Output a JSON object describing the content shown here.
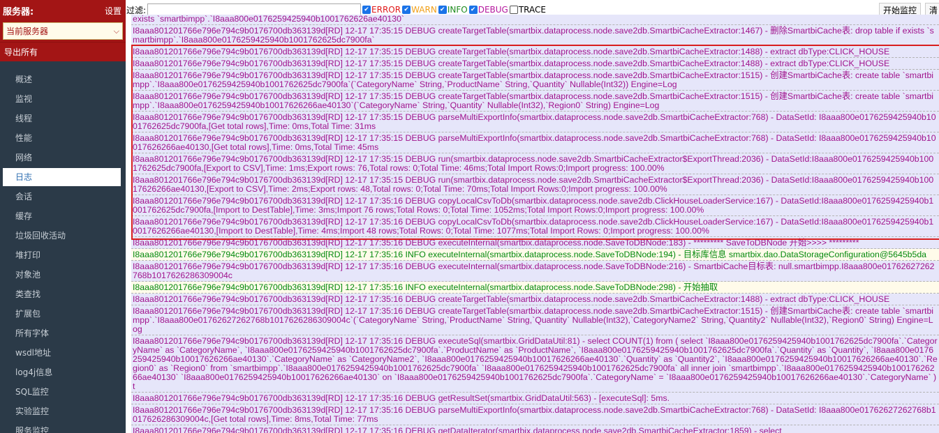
{
  "sidebar": {
    "title": "服务器:",
    "settings_label": "设置",
    "server_select": "当前服务器",
    "export_label": "导出所有",
    "items": [
      {
        "label": "概述"
      },
      {
        "label": "监视"
      },
      {
        "label": "线程"
      },
      {
        "label": "性能"
      },
      {
        "label": "网络"
      },
      {
        "label": "日志",
        "active": true
      },
      {
        "label": "会话"
      },
      {
        "label": "缓存"
      },
      {
        "label": "垃圾回收活动"
      },
      {
        "label": "堆打印"
      },
      {
        "label": "对象池"
      },
      {
        "label": "类查找"
      },
      {
        "label": "扩展包"
      },
      {
        "label": "所有字体"
      },
      {
        "label": "wsdl地址"
      },
      {
        "label": "log4j信息"
      },
      {
        "label": "SQL监控"
      },
      {
        "label": "实验监控"
      },
      {
        "label": "服务监控"
      }
    ]
  },
  "toolbar": {
    "filter_label": "过滤:",
    "filter_value": "",
    "levels": [
      {
        "label": "ERROR",
        "checked": true,
        "color": "#e01b1b"
      },
      {
        "label": "WARN",
        "checked": true,
        "color": "#f0a01a"
      },
      {
        "label": "INFO",
        "checked": true,
        "color": "#1f8c1f"
      },
      {
        "label": "DEBUG",
        "checked": true,
        "color": "#b5179e"
      },
      {
        "label": "TRACE",
        "checked": false,
        "color": "#000000"
      }
    ],
    "start_button": "开始监控",
    "clear_button": "清"
  },
  "log": [
    {
      "level": "debug",
      "text": "exists `smartbimpp`.`I8aaa800e0176259425940b1001762626ae40130`"
    },
    {
      "level": "debug",
      "text": "I8aaa801201766e796e794c9b0176700db363139d[RD] 12-17 17:35:15 DEBUG createTargetTable(smartbix.dataprocess.node.save2db.SmartbiCacheExtractor:1467) - 删除SmartbiCache表: drop table if exists `smartbimpp`.`I8aaa800e0176259425940b1001762625dc7900fa`"
    },
    {
      "level": "debug",
      "text": "I8aaa801201766e796e794c9b0176700db363139d[RD] 12-17 17:35:15 DEBUG createTargetTable(smartbix.dataprocess.node.save2db.SmartbiCacheExtractor:1488) - extract dbType:CLICK_HOUSE"
    },
    {
      "level": "debug",
      "text": "I8aaa801201766e796e794c9b0176700db363139d[RD] 12-17 17:35:15 DEBUG createTargetTable(smartbix.dataprocess.node.save2db.SmartbiCacheExtractor:1488) - extract dbType:CLICK_HOUSE"
    },
    {
      "level": "debug",
      "text": "I8aaa801201766e796e794c9b0176700db363139d[RD] 12-17 17:35:15 DEBUG createTargetTable(smartbix.dataprocess.node.save2db.SmartbiCacheExtractor:1515) - 创建SmartbiCache表: create table `smartbimpp`.`I8aaa800e0176259425940b1001762625dc7900fa`(`CategoryName` String,`ProductName` String,`Quantity` Nullable(Int32)) Engine=Log"
    },
    {
      "level": "debug",
      "text": "I8aaa801201766e796e794c9b0176700db363139d[RD] 12-17 17:35:15 DEBUG createTargetTable(smartbix.dataprocess.node.save2db.SmartbiCacheExtractor:1515) - 创建SmartbiCache表: create table `smartbimpp`.`I8aaa800e0176259425940b10017626266ae40130`(`CategoryName` String,`Quantity` Nullable(Int32),`Region0` String) Engine=Log"
    },
    {
      "level": "debug",
      "text": "I8aaa801201766e796e794c9b0176700db363139d[RD] 12-17 17:35:15 DEBUG parseMultiExportInfo(smartbix.dataprocess.node.save2db.SmartbiCacheExtractor:768) - DataSetId: I8aaa800e0176259425940b1001762625dc7900fa,[Get total rows],Time: 0ms,Total Time: 31ms"
    },
    {
      "level": "debug",
      "text": "I8aaa801201766e796e794c9b0176700db363139d[RD] 12-17 17:35:15 DEBUG parseMultiExportInfo(smartbix.dataprocess.node.save2db.SmartbiCacheExtractor:768) - DataSetId: I8aaa800e0176259425940b10017626266ae40130,[Get total rows],Time: 0ms,Total Time: 45ms"
    },
    {
      "level": "debug",
      "text": "I8aaa801201766e796e794c9b0176700db363139d[RD] 12-17 17:35:15 DEBUG run(smartbix.dataprocess.node.save2db.SmartbiCacheExtractor$ExportThread:2036) - DataSetId:I8aaa800e0176259425940b1001762625dc7900fa,[Export to CSV],Time: 1ms;Export rows: 76,Total rows: 0;Total Time: 46ms;Total Import Rows:0;Import progress: 100.00%"
    },
    {
      "level": "debug",
      "text": "I8aaa801201766e796e794c9b0176700db363139d[RD] 12-17 17:35:15 DEBUG run(smartbix.dataprocess.node.save2db.SmartbiCacheExtractor$ExportThread:2036) - DataSetId:I8aaa800e0176259425940b10017626266ae40130,[Export to CSV],Time: 2ms;Export rows: 48,Total rows: 0;Total Time: 70ms;Total Import Rows:0;Import progress: 100.00%"
    },
    {
      "level": "debug",
      "text": "I8aaa801201766e796e794c9b0176700db363139d[RD] 12-17 17:35:16 DEBUG copyLocalCsvToDb(smartbix.dataprocess.node.save2db.ClickHouseLoaderService:167) - DataSetId:I8aaa800e0176259425940b1001762625dc7900fa,[Import to DestTable],Time: 3ms;Import 76 rows;Total Rows: 0;Total Time: 1052ms;Total Import Rows:0;Import progress: 100.00%"
    },
    {
      "level": "debug",
      "text": "I8aaa801201766e796e794c9b0176700db363139d[RD] 12-17 17:35:16 DEBUG copyLocalCsvToDb(smartbix.dataprocess.node.save2db.ClickHouseLoaderService:167) - DataSetId:I8aaa800e0176259425940b10017626266ae40130,[Import to DestTable],Time: 4ms;Import 48 rows;Total Rows: 0;Total Time: 1077ms;Total Import Rows: 0;Import progress: 100.00%"
    },
    {
      "level": "debug",
      "text": "I8aaa801201766e796e794c9b0176700db363139d[RD] 12-17 17:35:16 DEBUG executeInternal(smartbix.dataprocess.node.SaveToDBNode:183) - ********* SaveToDBNode 开始>>>> *********"
    },
    {
      "level": "info",
      "text": "I8aaa801201766e796e794c9b0176700db363139d[RD] 12-17 17:35:16 INFO executeInternal(smartbix.dataprocess.node.SaveToDBNode:194) - 目标库信息 smartbix.dao.DataStorageConfiguration@5645b5da"
    },
    {
      "level": "debug",
      "text": "I8aaa801201766e796e794c9b0176700db363139d[RD] 12-17 17:35:16 DEBUG executeInternal(smartbix.dataprocess.node.SaveToDBNode:216) - SmartbiCache目标表: null.smartbimpp.I8aaa800e01762627262768b1017626286309004c"
    },
    {
      "level": "info",
      "text": "I8aaa801201766e796e794c9b0176700db363139d[RD] 12-17 17:35:16 INFO executeInternal(smartbix.dataprocess.node.SaveToDBNode:298) - 开始抽取"
    },
    {
      "level": "debug",
      "text": "I8aaa801201766e796e794c9b0176700db363139d[RD] 12-17 17:35:16 DEBUG createTargetTable(smartbix.dataprocess.node.save2db.SmartbiCacheExtractor:1488) - extract dbType:CLICK_HOUSE"
    },
    {
      "level": "debug",
      "text": "I8aaa801201766e796e794c9b0176700db363139d[RD] 12-17 17:35:16 DEBUG createTargetTable(smartbix.dataprocess.node.save2db.SmartbiCacheExtractor:1515) - 创建SmartbiCache表: create table `smartbimpp`.`I8aaa800e01762627262768b1017626286309004c`(`CategoryName` String,`ProductName` String,`Quantity` Nullable(Int32),`CategoryName2` String,`Quantity2` Nullable(Int32),`Region0` String) Engine=Log"
    },
    {
      "level": "debug",
      "text": "I8aaa801201766e796e794c9b0176700db363139d[RD] 12-17 17:35:16 DEBUG executeSql(smartbix.GridDataUtil:81) - select COUNT(1) from ( select `I8aaa800e0176259425940b1001762625dc7900fa`.`CategoryName` as `CategoryName`, `I8aaa800e0176259425940b1001762625dc7900fa`.`ProductName` as `ProductName`, `I8aaa800e0176259425940b1001762625dc7900fa`.`Quantity` as `Quantity`, `I8aaa800e0176259425940b10017626266ae40130`.`CategoryName` as `CategoryName2`, `I8aaa800e0176259425940b10017626266ae40130`.`Quantity` as `Quantity2`, `I8aaa800e0176259425940b10017626266ae40130`.`Region0` as `Region0` from `smartbimpp`.`I8aaa800e0176259425940b1001762625dc7900fa` `I8aaa800e0176259425940b1001762625dc7900fa` all inner join `smartbimpp`.`I8aaa800e0176259425940b10017626266ae40130` `I8aaa800e0176259425940b10017626266ae40130` on `I8aaa800e0176259425940b1001762625dc7900fa`.`CategoryName` = `I8aaa800e0176259425940b10017626266ae40130`.`CategoryName` ) t"
    },
    {
      "level": "debug",
      "text": "I8aaa801201766e796e794c9b0176700db363139d[RD] 12-17 17:35:16 DEBUG getResultSet(smartbix.GridDataUtil:563) - [executeSql]: 5ms."
    },
    {
      "level": "debug",
      "text": "I8aaa801201766e796e794c9b0176700db363139d[RD] 12-17 17:35:16 DEBUG parseMultiExportInfo(smartbix.dataprocess.node.save2db.SmartbiCacheExtractor:768) - DataSetId: I8aaa800e01762627262768b1017626286309004c,[Get total rows],Time: 8ms,Total Time: 77ms"
    },
    {
      "level": "debug",
      "text": "I8aaa801201766e796e794c9b0176700db363139d[RD] 12-17 17:35:16 DEBUG getDataIterator(smartbix.dataprocess.node.save2db.SmartbiCacheExtractor:1859) - select"
    }
  ]
}
